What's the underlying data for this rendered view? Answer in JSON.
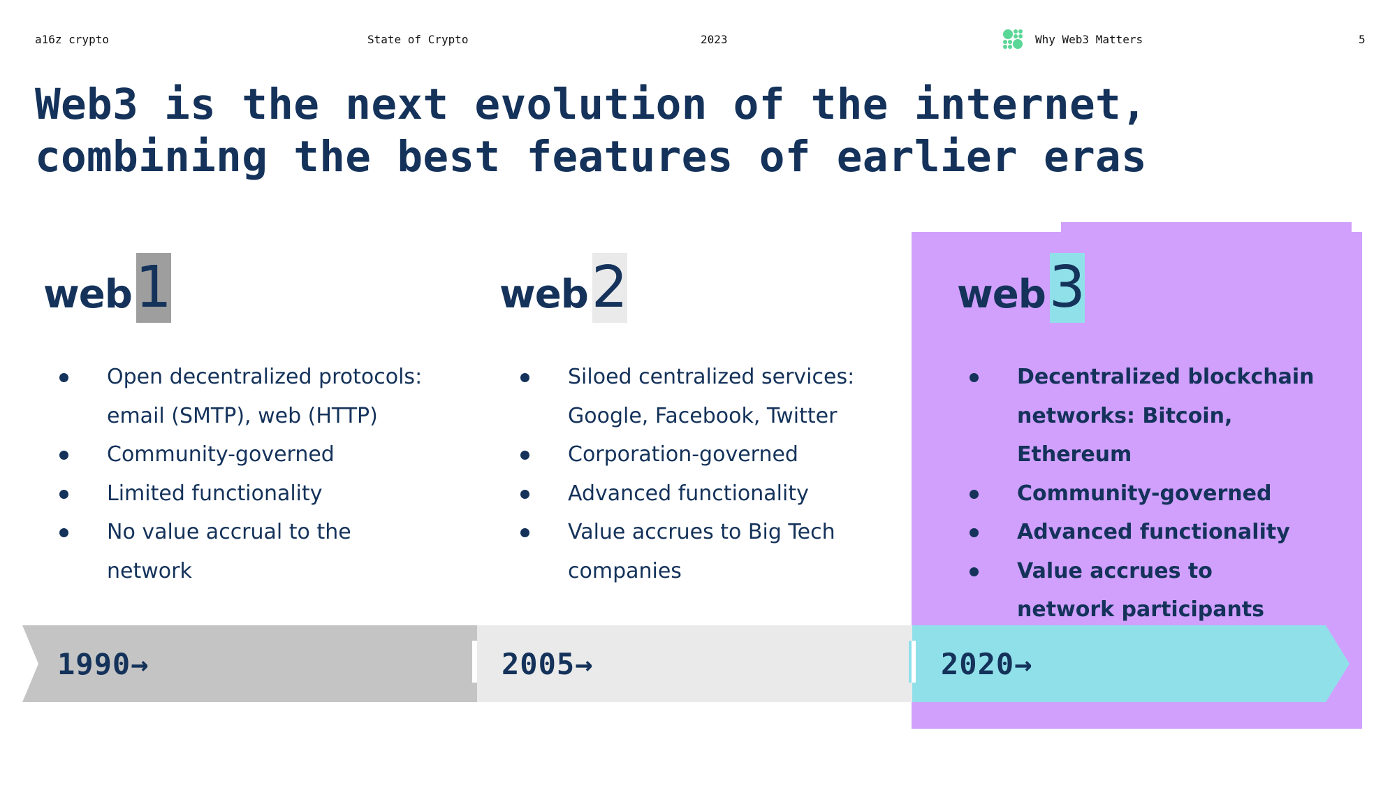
{
  "header": {
    "brand": "a16z crypto",
    "report": "State of Crypto",
    "year": "2023",
    "section_icon": "a16z-dots-logo-icon",
    "section": "Why Web3 Matters",
    "page_number": "5"
  },
  "title": {
    "line1": "Web3 is the next evolution of the internet,",
    "line2": "combining the best features of earlier eras"
  },
  "colors": {
    "navy": "#14325a",
    "web1_accent": "#9e9e9e",
    "web2_accent": "#eaeaea",
    "web3_accent": "#90e0ea",
    "web3_panel": "#d0a0fc",
    "logo_green": "#5ad696",
    "timeline_web1": "#c4c4c4"
  },
  "eras": [
    {
      "prefix": "web",
      "number": "1",
      "year_label": "1990→",
      "bullets": [
        "Open decentralized protocols: email (SMTP), web (HTTP)",
        "Community-governed",
        "Limited functionality",
        "No value accrual to the network"
      ]
    },
    {
      "prefix": "web",
      "number": "2",
      "year_label": "2005→",
      "bullets": [
        "Siloed centralized services: Google, Facebook, Twitter",
        "Corporation-governed",
        "Advanced functionality",
        "Value accrues to Big Tech companies"
      ]
    },
    {
      "prefix": "web",
      "number": "3",
      "year_label": "2020→",
      "bullets": [
        "Decentralized blockchain networks: Bitcoin, Ethereum",
        "Community-governed",
        "Advanced functionality",
        "Value accrues to network participants"
      ]
    }
  ]
}
